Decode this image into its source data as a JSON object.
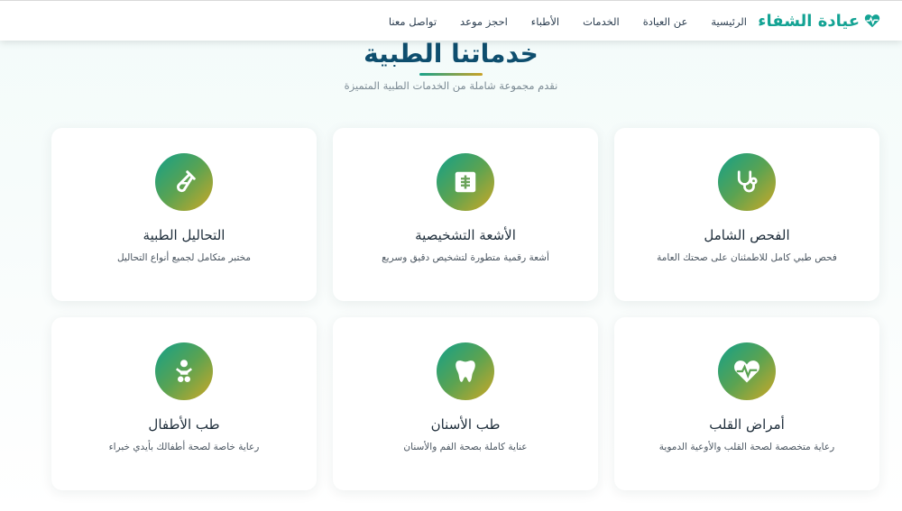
{
  "brand": {
    "name": "عيادة الشفاء",
    "icon": "heartbeat-icon",
    "color": "#14a394"
  },
  "nav": {
    "items": [
      {
        "label": "الرئيسية"
      },
      {
        "label": "عن العيادة"
      },
      {
        "label": "الخدمات"
      },
      {
        "label": "الأطباء"
      },
      {
        "label": "احجز موعد"
      },
      {
        "label": "تواصل معنا"
      }
    ]
  },
  "hero": {
    "title": "خدماتنا الطبية",
    "subtitle": "نقدم مجموعة شاملة من الخدمات الطبية المتميزة"
  },
  "services": [
    {
      "icon": "stethoscope-icon",
      "title": "الفحص الشامل",
      "desc": "فحص طبي كامل للاطمئنان على صحتك العامة"
    },
    {
      "icon": "x-ray-icon",
      "title": "الأشعة التشخيصية",
      "desc": "أشعة رقمية متطورة لتشخيص دقيق وسريع"
    },
    {
      "icon": "test-tube-icon",
      "title": "التحاليل الطبية",
      "desc": "مختبر متكامل لجميع أنواع التحاليل"
    },
    {
      "icon": "heart-pulse-icon",
      "title": "أمراض القلب",
      "desc": "رعاية متخصصة لصحة القلب والأوعية الدموية"
    },
    {
      "icon": "tooth-icon",
      "title": "طب الأسنان",
      "desc": "عناية كاملة بصحة الفم والأسنان"
    },
    {
      "icon": "baby-icon",
      "title": "طب الأطفال",
      "desc": "رعاية خاصة لصحة أطفالك بأيدي خبراء"
    }
  ],
  "colors": {
    "accent": "#14a394",
    "title": "#0e4e6e",
    "gradient_start": "#12a08a",
    "gradient_end": "#cfa825"
  }
}
